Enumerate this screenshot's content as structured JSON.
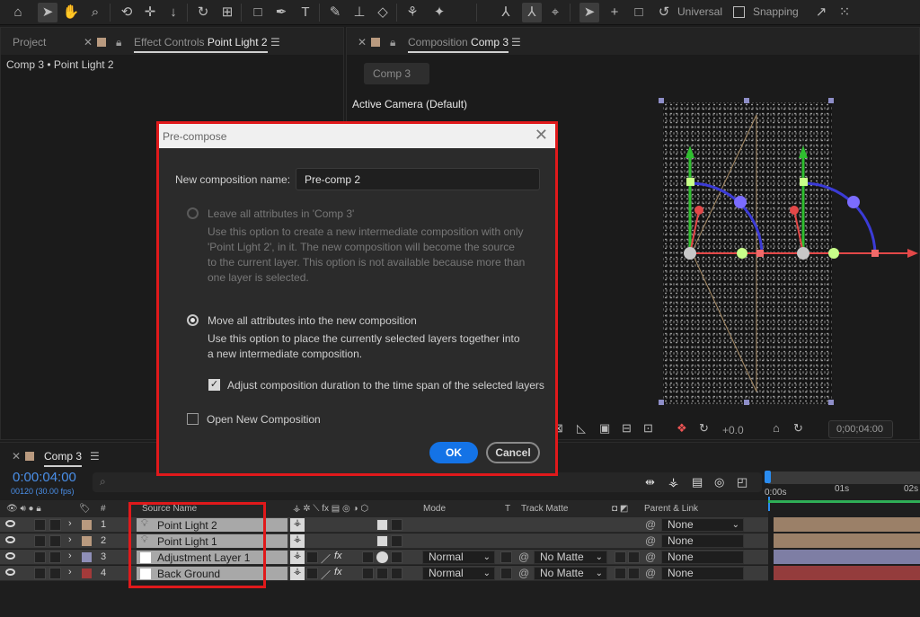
{
  "toolbar": {
    "universal_label": "Universal",
    "snapping_label": "Snapping"
  },
  "left_panel": {
    "tab_project": "Project",
    "tab_effect_controls_prefix": "Effect Controls",
    "tab_effect_controls_layer": "Point Light 2",
    "breadcrumb": "Comp 3 • Point Light 2"
  },
  "comp_panel": {
    "tab_prefix": "Composition",
    "tab_name": "Comp 3",
    "sub_tab": "Comp 3",
    "camera_label": "Active Camera (Default)",
    "exposure_value": "+0.0",
    "timecode": "0;00;04:00"
  },
  "dialog": {
    "title": "Pre-compose",
    "name_label": "New composition name:",
    "name_value": "Pre-comp 2",
    "option1_label": "Leave all attributes in 'Comp 3'",
    "option1_desc": "Use this option to create a new intermediate composition with only 'Point Light 2', in it. The new composition will become the source to the current layer. This option is not available because more than one layer is selected.",
    "option2_label": "Move all attributes into the new composition",
    "option2_desc": "Use this option to place the currently selected layers together into a new intermediate composition.",
    "adjust_duration_label": "Adjust composition duration to the time span of the selected layers",
    "open_new_label": "Open New Composition",
    "ok_label": "OK",
    "cancel_label": "Cancel"
  },
  "timeline": {
    "tab_name": "Comp 3",
    "timecode": "0:00:04:00",
    "frame_info": "00120 (30.00 fps)",
    "search_placeholder": "",
    "columns": {
      "number": "#",
      "source_name": "Source Name",
      "mode": "Mode",
      "t": "T",
      "track_matte": "Track Matte",
      "parent_link": "Parent & Link"
    },
    "ruler": [
      "0:00s",
      "01s",
      "02s"
    ],
    "layers": [
      {
        "num": "1",
        "name": "Point Light 2",
        "label_color": "#b99a7f",
        "mode": "",
        "track_matte": "",
        "parent": "None",
        "bar_color": "#9b8068"
      },
      {
        "num": "2",
        "name": "Point Light 1",
        "label_color": "#b99a7f",
        "mode": "",
        "track_matte": "",
        "parent": "None",
        "bar_color": "#9b8068"
      },
      {
        "num": "3",
        "name": "Adjustment Layer 1",
        "label_color": "#8f8fb8",
        "mode": "Normal",
        "track_matte": "No Matte",
        "parent": "None",
        "bar_color": "#7e7ea4"
      },
      {
        "num": "4",
        "name": "Back Ground",
        "label_color": "#a33a3a",
        "mode": "Normal",
        "track_matte": "No Matte",
        "parent": "None",
        "bar_color": "#943c3c"
      }
    ]
  },
  "colors": {
    "highlight_red": "#e0191b",
    "accent_blue": "#1473e6",
    "timecode_blue": "#4a8fe8"
  }
}
